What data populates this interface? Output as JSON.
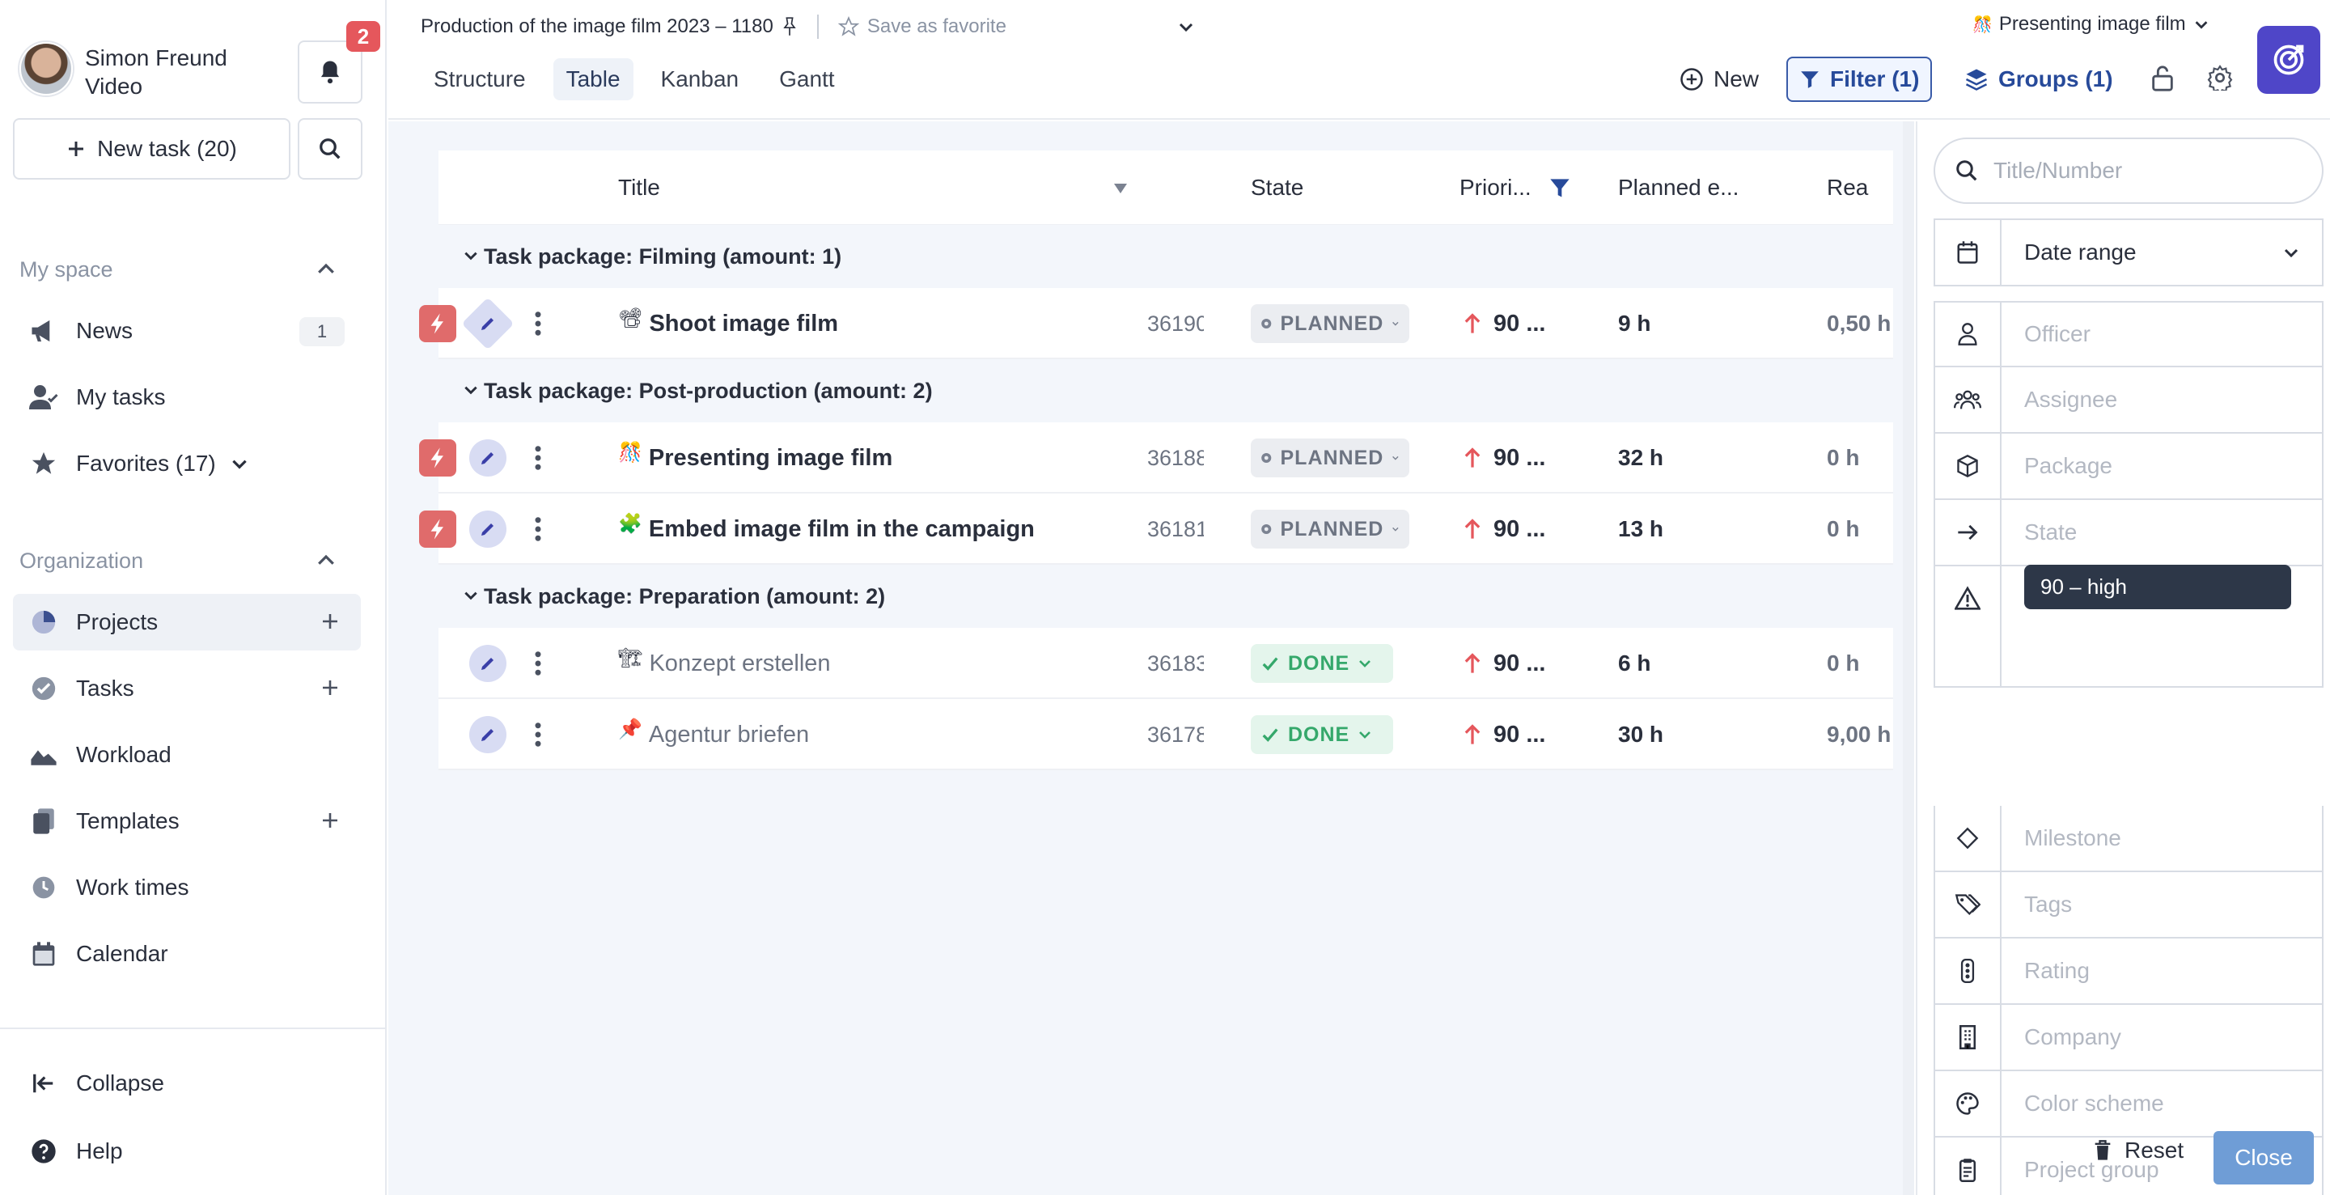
{
  "user": {
    "name": "Simon Freund",
    "role": "Video",
    "notifications": "2"
  },
  "sidebar": {
    "new_task": "New task (20)",
    "my_space_title": "My space",
    "my_space": [
      {
        "label": "News",
        "count": "1"
      },
      {
        "label": "My tasks"
      },
      {
        "label": "Favorites (17)"
      }
    ],
    "organization_title": "Organization",
    "organization": [
      {
        "label": "Projects"
      },
      {
        "label": "Tasks"
      },
      {
        "label": "Workload"
      },
      {
        "label": "Templates"
      },
      {
        "label": "Work times"
      },
      {
        "label": "Calendar"
      }
    ],
    "collapse": "Collapse",
    "help": "Help"
  },
  "topbar": {
    "project_title": "Production of the image film 2023 – 1180",
    "save_favorite": "Save as favorite",
    "selected_task": "Presenting image film",
    "tabs": [
      "Structure",
      "Table",
      "Kanban",
      "Gantt"
    ],
    "active_tab": "Table",
    "new": "New",
    "filter": "Filter (1)",
    "groups": "Groups (1)"
  },
  "table": {
    "columns": {
      "title": "Title",
      "state": "State",
      "priority": "Priori...",
      "planned": "Planned e...",
      "real": "Rea"
    },
    "groups": [
      {
        "label": "Task package: Filming (amount: 1)",
        "rows": [
          {
            "emoji": "📽",
            "title": "Shoot image film",
            "number": "36190",
            "state": "PLANNED",
            "priority": "90 ...",
            "planned": "9 h",
            "real": "0,50 h"
          }
        ]
      },
      {
        "label": "Task package: Post-production (amount: 2)",
        "rows": [
          {
            "emoji": "🎊",
            "title": "Presenting image film",
            "number": "36188",
            "state": "PLANNED",
            "priority": "90 ...",
            "planned": "32 h",
            "real": "0 h"
          },
          {
            "emoji": "🧩",
            "title": "Embed image film in the campaign",
            "number": "36181",
            "state": "PLANNED",
            "priority": "90 ...",
            "planned": "13 h",
            "real": "0 h"
          }
        ]
      },
      {
        "label": "Task package: Preparation (amount: 2)",
        "rows": [
          {
            "emoji": "🏗",
            "title": "Konzept erstellen",
            "number": "36183",
            "state": "DONE",
            "priority": "90 ...",
            "planned": "6 h",
            "real": "0 h"
          },
          {
            "emoji": "📌",
            "title": "Agentur briefen",
            "number": "36178",
            "state": "DONE",
            "priority": "90 ...",
            "planned": "30 h",
            "real": "9,00 h"
          }
        ]
      }
    ]
  },
  "filters": {
    "search_placeholder": "Title/Number",
    "date_range": "Date range",
    "officer": "Officer",
    "assignee": "Assignee",
    "package": "Package",
    "state": "State",
    "priority_chip": "90 – high",
    "milestone": "Milestone",
    "tags": "Tags",
    "rating": "Rating",
    "company": "Company",
    "color_scheme": "Color scheme",
    "project_group": "Project group",
    "reset": "Reset",
    "close": "Close"
  },
  "colors": {
    "accent": "#274a9a",
    "app_button": "#4f46c8",
    "urgent": "#e06b6b",
    "done": "#35a86b",
    "close_button": "#6f9dd6"
  }
}
